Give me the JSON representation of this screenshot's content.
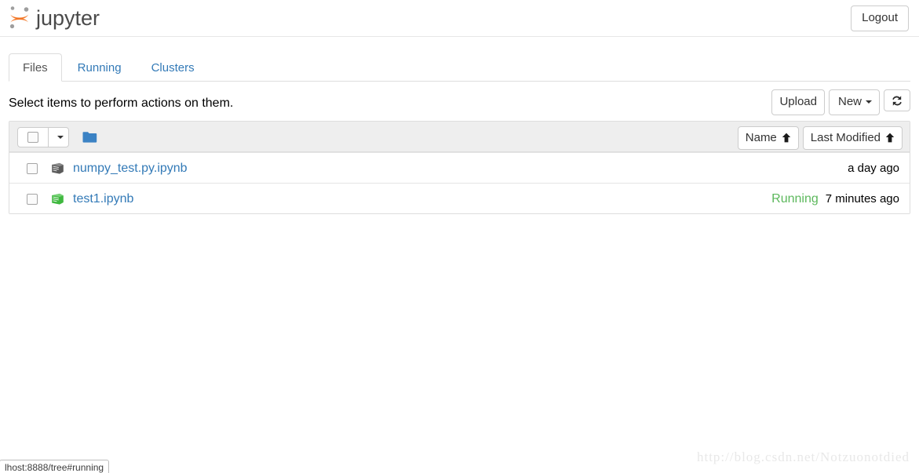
{
  "header": {
    "brand_text": "jupyter",
    "brand_logo_icon": "jupyter-logo-icon",
    "logout_label": "Logout"
  },
  "tabs": [
    {
      "label": "Files",
      "active": true
    },
    {
      "label": "Running",
      "active": false
    },
    {
      "label": "Clusters",
      "active": false
    }
  ],
  "toolbar": {
    "message": "Select items to perform actions on them.",
    "upload_label": "Upload",
    "new_label": "New",
    "new_caret_icon": "chevron-down-icon",
    "refresh_icon": "refresh-icon"
  },
  "table": {
    "select_all_checkbox_icon": "checkbox-icon",
    "select_all_caret_icon": "chevron-down-icon",
    "breadcrumb_folder_icon": "folder-icon",
    "sort_name_label": "Name",
    "sort_name_arrow_icon": "arrow-up-icon",
    "sort_modified_label": "Last Modified",
    "sort_modified_arrow_icon": "arrow-up-icon",
    "rows": [
      {
        "checkbox_icon": "checkbox-icon",
        "file_icon": "notebook-icon",
        "name": "numpy_test.py.ipynb",
        "running": "",
        "modified": "a day ago"
      },
      {
        "checkbox_icon": "checkbox-icon",
        "file_icon": "notebook-running-icon",
        "name": "test1.ipynb",
        "running": "Running",
        "modified": "7 minutes ago"
      }
    ]
  },
  "watermark": {
    "text": "http://blog.csdn.net/Notzuonotdied"
  },
  "status_bar": {
    "url": "lhost:8888/tree#running"
  },
  "colors": {
    "brand_orange": "#f37726",
    "link_blue": "#337ab7",
    "running_green": "#5cb85c",
    "folder_blue": "#3b82c4",
    "border_gray": "#dddddd",
    "header_bg": "#eeeeee"
  }
}
